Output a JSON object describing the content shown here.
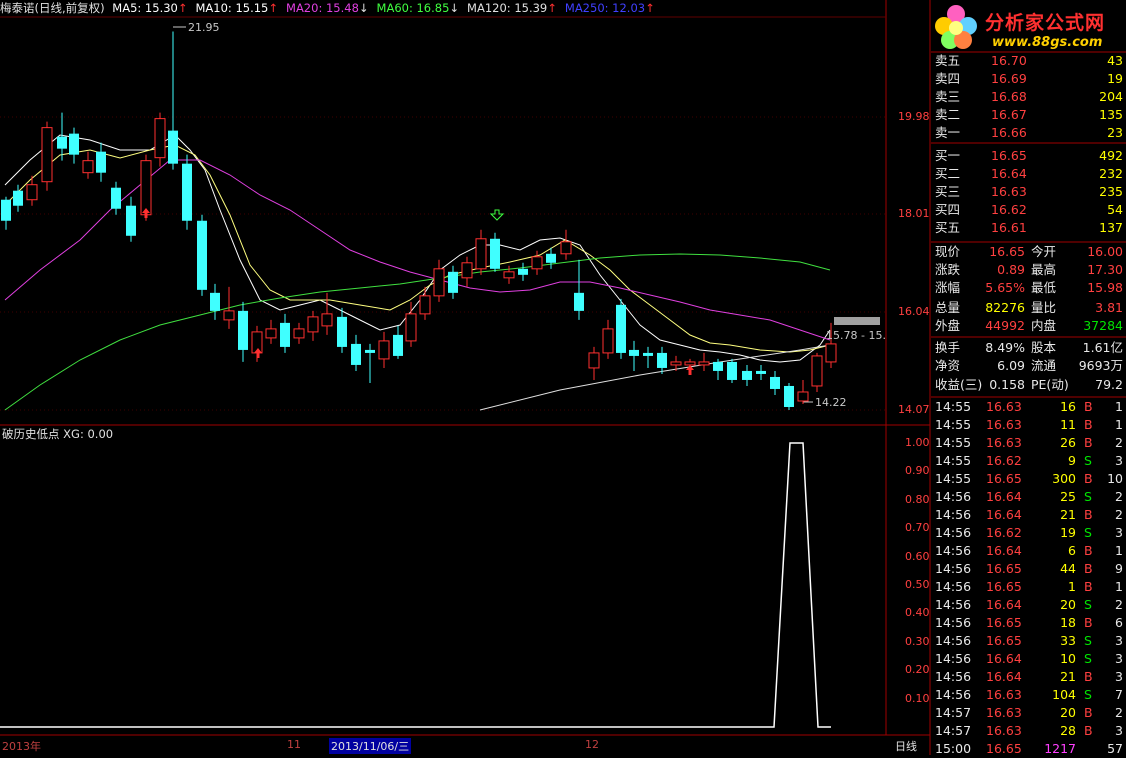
{
  "header": {
    "stock_title": "梅泰诺(日线,前复权)",
    "ma_items": [
      {
        "label": "MA5: 15.30",
        "color": "#ffffff",
        "arrow": "↑",
        "arrow_color": "#ff3030"
      },
      {
        "label": "MA10: 15.15",
        "color": "#ffffff",
        "arrow": "↑",
        "arrow_color": "#ff3030"
      },
      {
        "label": "MA20: 15.48",
        "color": "#e040e0",
        "arrow": "↓",
        "arrow_color": "#e0e0e0"
      },
      {
        "label": "MA60: 16.85",
        "color": "#40ff40",
        "arrow": "↓",
        "arrow_color": "#e0e0e0"
      },
      {
        "label": "MA120: 15.39",
        "color": "#e0e0e0",
        "arrow": "↑",
        "arrow_color": "#ff3030"
      },
      {
        "label": "MA250: 12.03",
        "color": "#4040ff",
        "arrow": "↑",
        "arrow_color": "#ff3030"
      }
    ]
  },
  "logo": {
    "name": "分析家公式网",
    "url": "www.88gs.com"
  },
  "main_chart": {
    "price_ticks": [
      "19.98",
      "18.01",
      "16.04",
      "14.07"
    ],
    "annotations": {
      "high": "21.95",
      "low": "14.22",
      "current_range": "15.78 - 15."
    },
    "colors": {
      "up": "#ff3030",
      "down": "#40ffff",
      "ma5": "#ffffff",
      "ma10": "#ffff80",
      "ma20": "#e040e0",
      "ma60": "#40e040",
      "ma120": "#e0e0e0"
    }
  },
  "indicator": {
    "title": "破历史低点 XG: 0.00",
    "ticks": [
      "1.00",
      "0.90",
      "0.80",
      "0.70",
      "0.60",
      "0.50",
      "0.40",
      "0.30",
      "0.20",
      "0.10"
    ]
  },
  "x_axis": {
    "labels": [
      "2013年",
      "11",
      "2013/11/06/三",
      "12"
    ],
    "period": "日线"
  },
  "order_book": {
    "asks": [
      {
        "label": "卖五",
        "price": "16.70",
        "volume": "43"
      },
      {
        "label": "卖四",
        "price": "16.69",
        "volume": "19"
      },
      {
        "label": "卖三",
        "price": "16.68",
        "volume": "204"
      },
      {
        "label": "卖二",
        "price": "16.67",
        "volume": "135"
      },
      {
        "label": "卖一",
        "price": "16.66",
        "volume": "23"
      }
    ],
    "bids": [
      {
        "label": "买一",
        "price": "16.65",
        "volume": "492"
      },
      {
        "label": "买二",
        "price": "16.64",
        "volume": "232"
      },
      {
        "label": "买三",
        "price": "16.63",
        "volume": "235"
      },
      {
        "label": "买四",
        "price": "16.62",
        "volume": "54"
      },
      {
        "label": "买五",
        "price": "16.61",
        "volume": "137"
      }
    ]
  },
  "quote": [
    {
      "l1": "现价",
      "v1": "16.65",
      "c1": "red",
      "l2": "今开",
      "v2": "16.00",
      "c2": "red"
    },
    {
      "l1": "涨跌",
      "v1": "0.89",
      "c1": "red",
      "l2": "最高",
      "v2": "17.30",
      "c2": "red"
    },
    {
      "l1": "涨幅",
      "v1": "5.65%",
      "c1": "red",
      "l2": "最低",
      "v2": "15.98",
      "c2": "red"
    },
    {
      "l1": "总量",
      "v1": "82276",
      "c1": "yellow",
      "l2": "量比",
      "v2": "3.81",
      "c2": "red"
    },
    {
      "l1": "外盘",
      "v1": "44992",
      "c1": "red",
      "l2": "内盘",
      "v2": "37284",
      "c2": "green"
    },
    {
      "l1": "换手",
      "v1": "8.49%",
      "c1": "white",
      "l2": "股本",
      "v2": "1.61亿",
      "c2": "white"
    },
    {
      "l1": "净资",
      "v1": "6.09",
      "c1": "white",
      "l2": "流通",
      "v2": "9693万",
      "c2": "white"
    },
    {
      "l1": "收益(三)",
      "v1": "0.158",
      "c1": "white",
      "l2": "PE(动)",
      "v2": "79.2",
      "c2": "white"
    }
  ],
  "ticks_list": [
    {
      "time": "14:55",
      "price": "16.63",
      "vol": "16",
      "side": "B",
      "n": "1"
    },
    {
      "time": "14:55",
      "price": "16.63",
      "vol": "11",
      "side": "B",
      "n": "1"
    },
    {
      "time": "14:55",
      "price": "16.63",
      "vol": "26",
      "side": "B",
      "n": "2"
    },
    {
      "time": "14:55",
      "price": "16.62",
      "vol": "9",
      "side": "S",
      "n": "3"
    },
    {
      "time": "14:55",
      "price": "16.65",
      "vol": "300",
      "side": "B",
      "n": "10"
    },
    {
      "time": "14:56",
      "price": "16.64",
      "vol": "25",
      "side": "S",
      "n": "2"
    },
    {
      "time": "14:56",
      "price": "16.64",
      "vol": "21",
      "side": "B",
      "n": "2"
    },
    {
      "time": "14:56",
      "price": "16.62",
      "vol": "19",
      "side": "S",
      "n": "3"
    },
    {
      "time": "14:56",
      "price": "16.64",
      "vol": "6",
      "side": "B",
      "n": "1"
    },
    {
      "time": "14:56",
      "price": "16.65",
      "vol": "44",
      "side": "B",
      "n": "9"
    },
    {
      "time": "14:56",
      "price": "16.65",
      "vol": "1",
      "side": "B",
      "n": "1"
    },
    {
      "time": "14:56",
      "price": "16.64",
      "vol": "20",
      "side": "S",
      "n": "2"
    },
    {
      "time": "14:56",
      "price": "16.65",
      "vol": "18",
      "side": "B",
      "n": "6"
    },
    {
      "time": "14:56",
      "price": "16.65",
      "vol": "33",
      "side": "S",
      "n": "3"
    },
    {
      "time": "14:56",
      "price": "16.64",
      "vol": "10",
      "side": "S",
      "n": "3"
    },
    {
      "time": "14:56",
      "price": "16.64",
      "vol": "21",
      "side": "B",
      "n": "3"
    },
    {
      "time": "14:56",
      "price": "16.63",
      "vol": "104",
      "side": "S",
      "n": "7"
    },
    {
      "time": "14:57",
      "price": "16.63",
      "vol": "20",
      "side": "B",
      "n": "2"
    },
    {
      "time": "14:57",
      "price": "16.63",
      "vol": "28",
      "side": "B",
      "n": "3"
    },
    {
      "time": "15:00",
      "price": "16.65",
      "vol": "1217",
      "side": "",
      "n": "57"
    }
  ]
}
